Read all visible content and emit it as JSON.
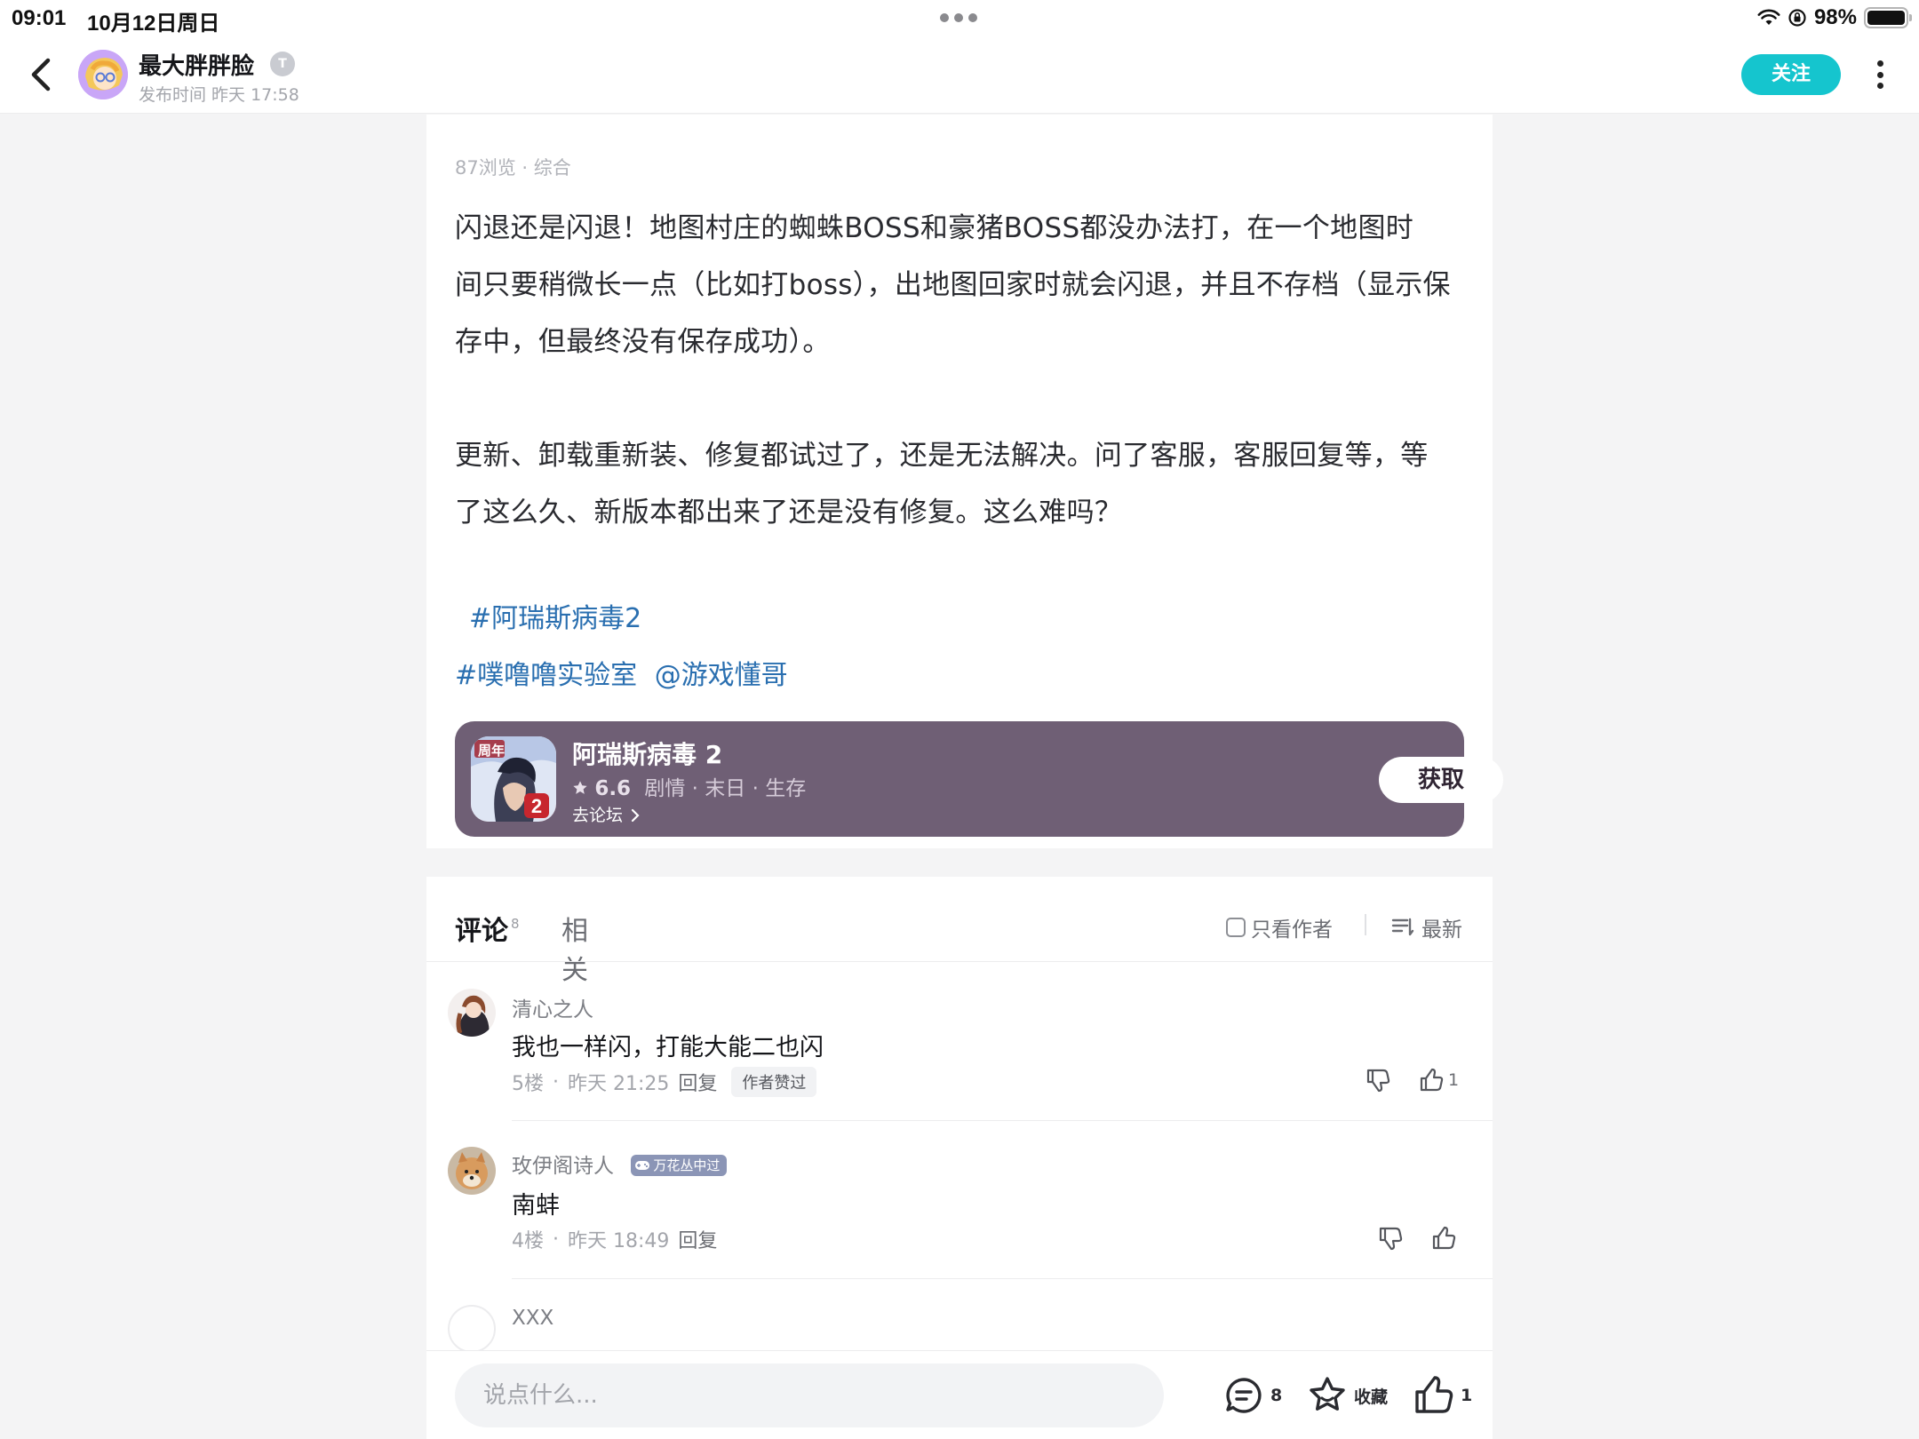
{
  "status_bar": {
    "time": "09:01",
    "date": "10月12日周日",
    "battery": "98%"
  },
  "nav": {
    "author_name": "最大胖胖脸",
    "author_badge": "T",
    "post_time": "发布时间 昨天 17:58",
    "follow_label": "关注"
  },
  "post": {
    "meta": "87浏览 · 综合",
    "paragraph1": [
      "闪退还是闪退！地图村庄的蜘蛛BOSS和豪猪BOSS都没办法打，在一个地图时",
      "间只要稍微长一点（比如打boss），出地图回家时就会闪退，并且不存档（显示保",
      "存中，但最终没有保存成功）。"
    ],
    "paragraph2": [
      "更新、卸载重新装、修复都试过了，还是无法解决。问了客服，客服回复等，等",
      "了这么久、新版本都出来了还是没有修复。这么难吗？"
    ],
    "tag1": "#阿瑞斯病毒2",
    "tag2": "#噗噜噜实验室",
    "mention": "@游戏懂哥"
  },
  "game_card": {
    "icon_label": "周年",
    "name": "阿瑞斯病毒 2",
    "rating": "6.6",
    "genres": "剧情 · 末日 · 生存",
    "forum_link": "去论坛",
    "get_label": "获取"
  },
  "comments_section": {
    "tab_comments": "评论",
    "comment_count": "8",
    "tab_related": "相关",
    "only_author": "只看作者",
    "sort_label": "最新",
    "items": [
      {
        "name": "清心之人",
        "text": "我也一样闪，打能大能二也闪",
        "floor": "5楼",
        "time": "昨天 21:25",
        "reply": "回复",
        "author_liked": "作者赞过",
        "likes": "1"
      },
      {
        "name": "玫伊阁诗人",
        "honor": "万花丛中过",
        "text": "南蚌",
        "floor": "4楼",
        "time": "昨天 18:49",
        "reply": "回复",
        "likes": ""
      },
      {
        "name": "XXX"
      }
    ]
  },
  "bottom_bar": {
    "placeholder": "说点什么...",
    "comment_count": "8",
    "favorite_label": "收藏",
    "like_count": "1"
  },
  "colors": {
    "accent": "#15c5ce",
    "tag_link": "#2a6fb0",
    "game_card_bg": "#6f5f75"
  }
}
